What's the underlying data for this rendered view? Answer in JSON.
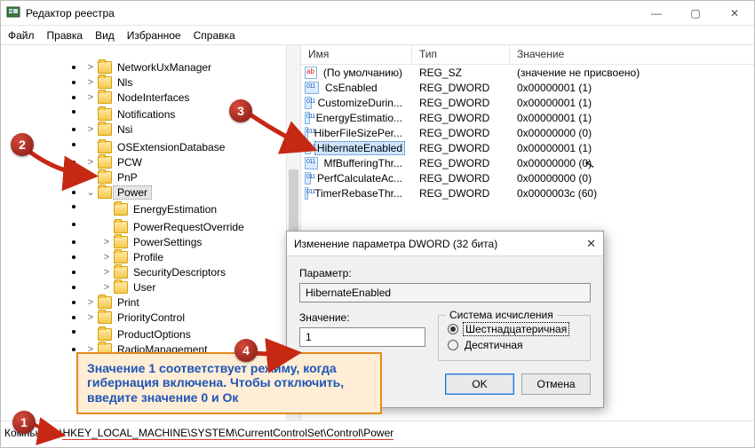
{
  "window": {
    "title": "Редактор реестра"
  },
  "menu": [
    "Файл",
    "Правка",
    "Вид",
    "Избранное",
    "Справка"
  ],
  "tree": [
    {
      "tw": ">",
      "label": "NetworkUxManager",
      "depth": 0
    },
    {
      "tw": ">",
      "label": "Nls",
      "depth": 0
    },
    {
      "tw": ">",
      "label": "NodeInterfaces",
      "depth": 0
    },
    {
      "tw": "",
      "label": "Notifications",
      "depth": 0
    },
    {
      "tw": ">",
      "label": "Nsi",
      "depth": 0
    },
    {
      "tw": "",
      "label": "OSExtensionDatabase",
      "depth": 0
    },
    {
      "tw": ">",
      "label": "PCW",
      "depth": 0
    },
    {
      "tw": ">",
      "label": "PnP",
      "depth": 0
    },
    {
      "tw": "v",
      "label": "Power",
      "depth": 0,
      "selected": true
    },
    {
      "tw": "",
      "label": "EnergyEstimation",
      "depth": 1
    },
    {
      "tw": "",
      "label": "PowerRequestOverride",
      "depth": 1
    },
    {
      "tw": ">",
      "label": "PowerSettings",
      "depth": 1
    },
    {
      "tw": ">",
      "label": "Profile",
      "depth": 1
    },
    {
      "tw": ">",
      "label": "SecurityDescriptors",
      "depth": 1
    },
    {
      "tw": ">",
      "label": "User",
      "depth": 1
    },
    {
      "tw": ">",
      "label": "Print",
      "depth": 0
    },
    {
      "tw": ">",
      "label": "PriorityControl",
      "depth": 0
    },
    {
      "tw": "",
      "label": "ProductOptions",
      "depth": 0
    },
    {
      "tw": ">",
      "label": "RadioManagement",
      "depth": 0
    }
  ],
  "columns": {
    "name": "Имя",
    "type": "Тип",
    "value": "Значение"
  },
  "values": [
    {
      "icon": "sz",
      "name": "(По умолчанию)",
      "type": "REG_SZ",
      "value": "(значение не присвоено)",
      "sel": false
    },
    {
      "icon": "dw",
      "name": "CsEnabled",
      "type": "REG_DWORD",
      "value": "0x00000001 (1)",
      "sel": false
    },
    {
      "icon": "dw",
      "name": "CustomizeDurin...",
      "type": "REG_DWORD",
      "value": "0x00000001 (1)",
      "sel": false
    },
    {
      "icon": "dw",
      "name": "EnergyEstimatio...",
      "type": "REG_DWORD",
      "value": "0x00000001 (1)",
      "sel": false
    },
    {
      "icon": "dw",
      "name": "HiberFileSizePer...",
      "type": "REG_DWORD",
      "value": "0x00000000 (0)",
      "sel": false
    },
    {
      "icon": "dw",
      "name": "HibernateEnabled",
      "type": "REG_DWORD",
      "value": "0x00000001 (1)",
      "sel": true
    },
    {
      "icon": "dw",
      "name": "MfBufferingThr...",
      "type": "REG_DWORD",
      "value": "0x00000000 (0)",
      "sel": false
    },
    {
      "icon": "dw",
      "name": "PerfCalculateAc...",
      "type": "REG_DWORD",
      "value": "0x00000000 (0)",
      "sel": false
    },
    {
      "icon": "dw",
      "name": "TimerRebaseThr...",
      "type": "REG_DWORD",
      "value": "0x0000003c (60)",
      "sel": false
    }
  ],
  "dialog": {
    "title": "Изменение параметра DWORD (32 бита)",
    "param_label": "Параметр:",
    "param_value": "HibernateEnabled",
    "value_label": "Значение:",
    "value_value": "1",
    "base_label": "Система исчисления",
    "radio_hex": "Шестнадцатеричная",
    "radio_dec": "Десятичная",
    "ok": "OK",
    "cancel": "Отмена"
  },
  "callout": "Значение 1 соответствует режиму, когда гибернация включена. Чтобы отключить, введите значение 0 и Ок",
  "status": {
    "prefix": "Компьютер\\",
    "highlight": "HKEY_LOCAL_MACHINE\\SYSTEM\\CurrentControlSet\\Control\\Power"
  },
  "badges": {
    "b1": "1",
    "b2": "2",
    "b3": "3",
    "b4": "4"
  }
}
